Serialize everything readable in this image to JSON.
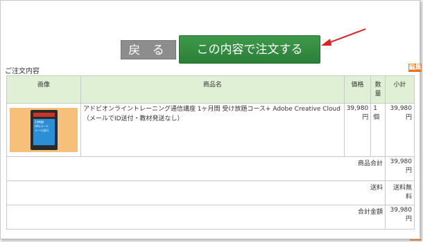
{
  "buttons": {
    "back_label": "戻 る",
    "order_label": "この内容で注文する"
  },
  "section": {
    "title": "ご注文内容",
    "edit_badge": "編集"
  },
  "table": {
    "headers": {
      "image": "画像",
      "product_name": "商品名",
      "price": "価格",
      "quantity": "数量",
      "subtotal": "小計"
    },
    "item": {
      "name": "アドビオンライントレーニング通信講座 1ヶ月間 受け放題コース+ Adobe Creative Cloud（メールでID送付・教材発送なし）",
      "price_line1": "39,980",
      "price_line2": "円",
      "quantity": "1個",
      "subtotal_line1": "39,980",
      "subtotal_line2": "円",
      "thumb_text_1": "24時間",
      "thumb_text_2": "URLコード",
      "thumb_text_3": "メール送付"
    },
    "summary": {
      "product_total_label": "商品合計",
      "product_total_line1": "39,980",
      "product_total_line2": "円",
      "shipping_label": "送料",
      "shipping_value": "送料無料",
      "grand_total_label": "合計金額",
      "grand_total_line1": "39,980",
      "grand_total_line2": "円"
    }
  },
  "colors": {
    "order_button": "#2f8b3c",
    "back_button": "#8d8d8d",
    "header_bg": "#e0f0d4",
    "edit_badge": "#e8731c",
    "arrow": "#e02020"
  }
}
